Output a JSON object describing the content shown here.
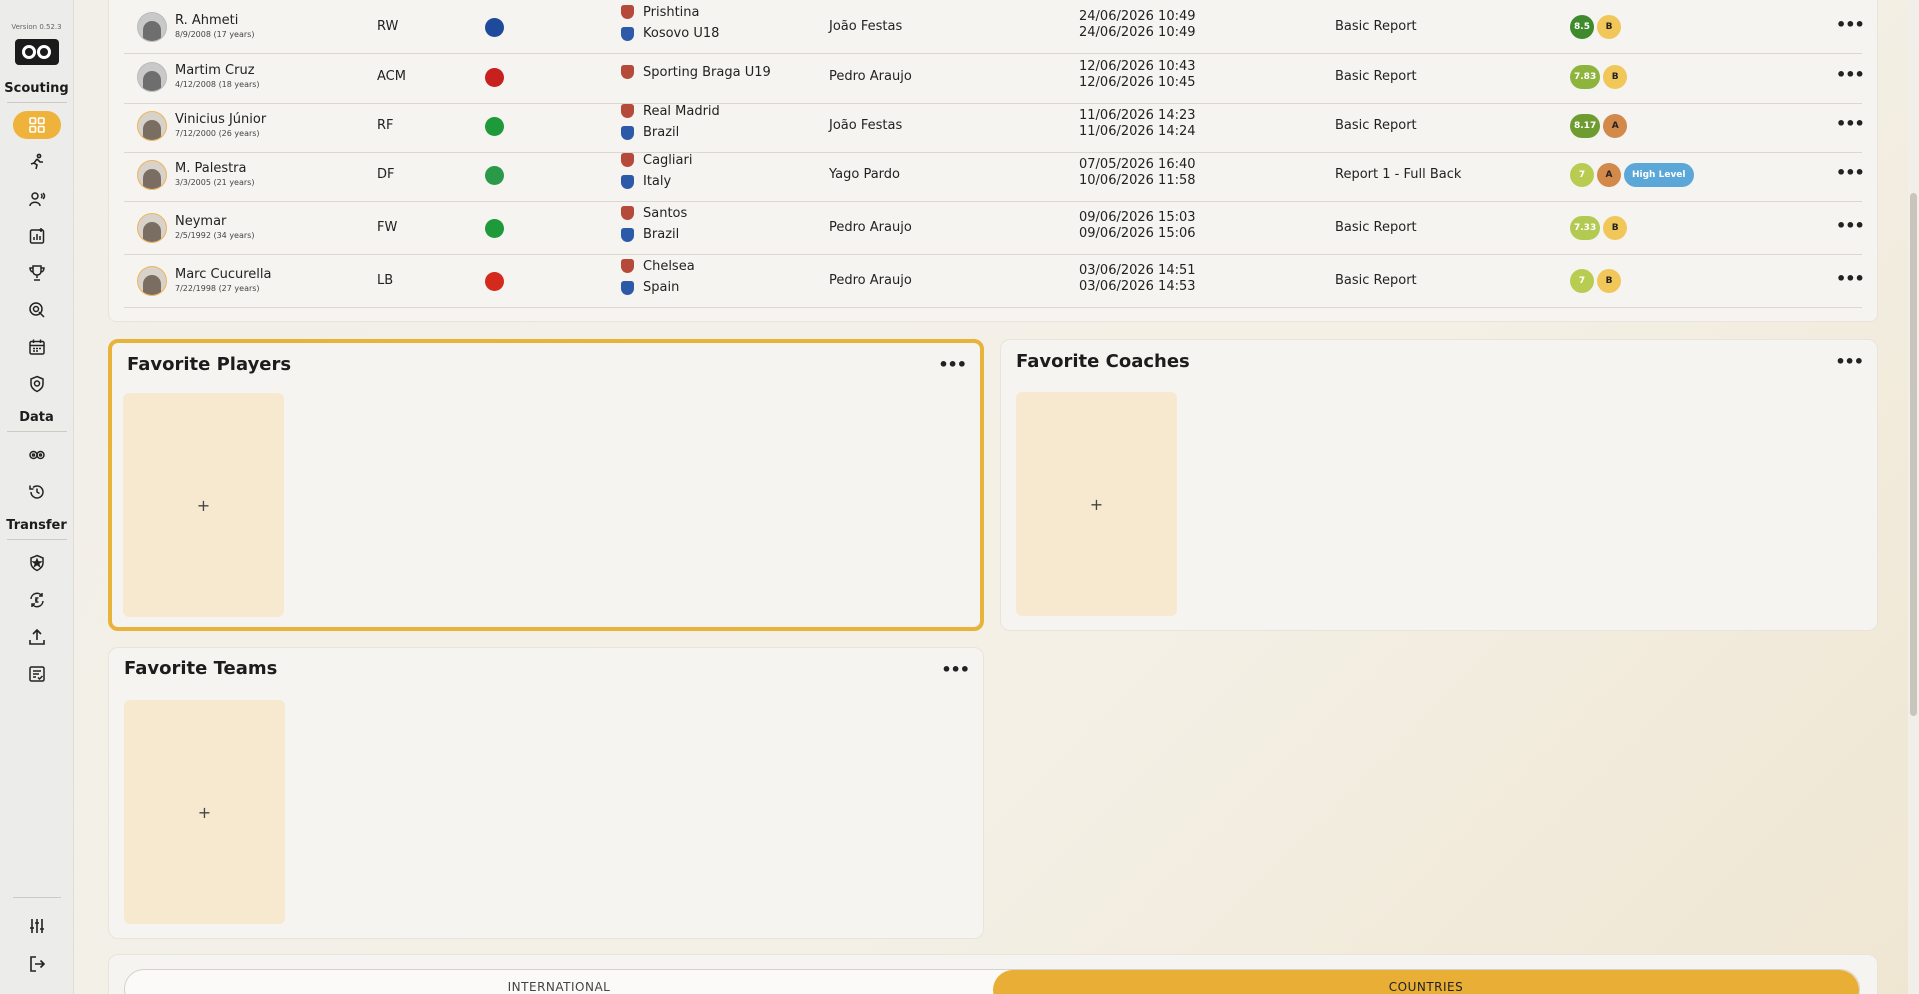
{
  "sidebar": {
    "version": "Version 0.52.3",
    "sections": {
      "scouting": "Scouting",
      "data": "Data",
      "transfer": "Transfer"
    }
  },
  "reports": [
    {
      "name": "R. Ahmeti",
      "dob": "8/9/2008 (17 years)",
      "position": "RW",
      "flag_color": "#1e4a9c",
      "club": "Prishtina",
      "club2": "Kosovo U18",
      "scout": "João Festas",
      "date1": "24/06/2026 10:49",
      "date2": "24/06/2026 10:49",
      "report": "Basic Report",
      "rating": "8.5",
      "rating_color": "#3e8a2c",
      "grade": "B",
      "grade_color": "#f1c75a",
      "tag": ""
    },
    {
      "name": "Martim Cruz",
      "dob": "4/12/2008 (18 years)",
      "position": "ACM",
      "flag_color": "#c8201f",
      "club": "Sporting Braga U19",
      "club2": "",
      "scout": "Pedro Araujo",
      "date1": "12/06/2026 10:43",
      "date2": "12/06/2026 10:45",
      "report": "Basic Report",
      "rating": "7.83",
      "rating_color": "#8fb43e",
      "grade": "B",
      "grade_color": "#f1c75a",
      "tag": ""
    },
    {
      "name": "Vinicius Júnior",
      "dob": "7/12/2000 (26 years)",
      "position": "RF",
      "flag_color": "#1f9a3a",
      "club": "Real Madrid",
      "club2": "Brazil",
      "scout": "João Festas",
      "date1": "11/06/2026 14:23",
      "date2": "11/06/2026 14:24",
      "report": "Basic Report",
      "rating": "8.17",
      "rating_color": "#6f9c30",
      "grade": "A",
      "grade_color": "#d3894a",
      "tag": ""
    },
    {
      "name": "M. Palestra",
      "dob": "3/3/2005 (21 years)",
      "position": "DF",
      "flag_color": "#2a9a48",
      "club": "Cagliari",
      "club2": "Italy",
      "scout": "Yago Pardo",
      "date1": "07/05/2026 16:40",
      "date2": "10/06/2026 11:58",
      "report": "Report 1 - Full Back",
      "rating": "7",
      "rating_color": "#b8cc52",
      "grade": "A",
      "grade_color": "#d3894a",
      "tag": "High Level"
    },
    {
      "name": "Neymar",
      "dob": "2/5/1992 (34 years)",
      "position": "FW",
      "flag_color": "#1f9a3a",
      "club": "Santos",
      "club2": "Brazil",
      "scout": "Pedro Araujo",
      "date1": "09/06/2026 15:03",
      "date2": "09/06/2026 15:06",
      "report": "Basic Report",
      "rating": "7.33",
      "rating_color": "#b3ca52",
      "grade": "B",
      "grade_color": "#f1c75a",
      "tag": ""
    },
    {
      "name": "Marc Cucurella",
      "dob": "7/22/1998 (27 years)",
      "position": "LB",
      "flag_color": "#d42a1e",
      "club": "Chelsea",
      "club2": "Spain",
      "scout": "Pedro Araujo",
      "date1": "03/06/2026 14:51",
      "date2": "03/06/2026 14:53",
      "report": "Basic Report",
      "rating": "7",
      "rating_color": "#b8cc52",
      "grade": "B",
      "grade_color": "#f1c75a",
      "tag": ""
    }
  ],
  "favorites": {
    "players_title": "Favorite Players",
    "coaches_title": "Favorite Coaches",
    "teams_title": "Favorite Teams",
    "add_symbol": "+"
  },
  "tabs": {
    "international": "INTERNATIONAL",
    "countries": "COUNTRIES"
  },
  "more_symbol": "•••"
}
